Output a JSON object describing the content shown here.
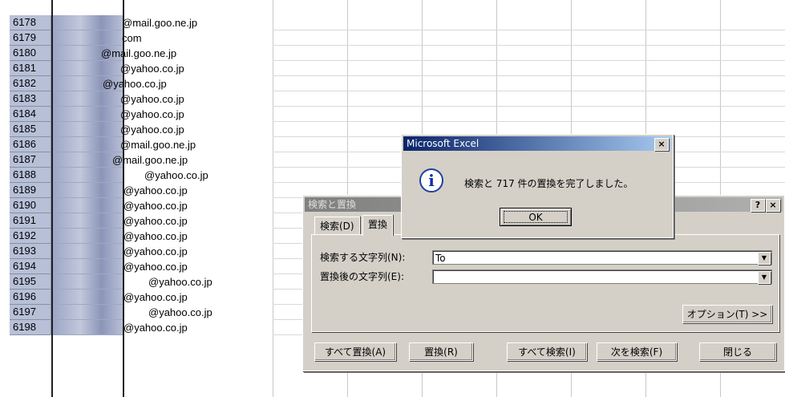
{
  "sheet": {
    "rows": [
      {
        "num": "6178",
        "email": "@mail.goo.ne.jp"
      },
      {
        "num": "6179",
        "email": "com"
      },
      {
        "num": "6180",
        "email": "@mail.goo.ne.jp"
      },
      {
        "num": "6181",
        "email": "@yahoo.co.jp"
      },
      {
        "num": "6182",
        "email": "@yahoo.co.jp"
      },
      {
        "num": "6183",
        "email": "@yahoo.co.jp"
      },
      {
        "num": "6184",
        "email": "@yahoo.co.jp"
      },
      {
        "num": "6185",
        "email": "@yahoo.co.jp"
      },
      {
        "num": "6186",
        "email": "@mail.goo.ne.jp"
      },
      {
        "num": "6187",
        "email": "@mail.goo.ne.jp"
      },
      {
        "num": "6188",
        "email": "@yahoo.co.jp"
      },
      {
        "num": "6189",
        "email": "@yahoo.co.jp"
      },
      {
        "num": "6190",
        "email": "@yahoo.co.jp"
      },
      {
        "num": "6191",
        "email": "@yahoo.co.jp"
      },
      {
        "num": "6192",
        "email": "@yahoo.co.jp"
      },
      {
        "num": "6193",
        "email": "@yahoo.co.jp"
      },
      {
        "num": "6194",
        "email": "@yahoo.co.jp"
      },
      {
        "num": "6195",
        "email": "@yahoo.co.jp"
      },
      {
        "num": "6196",
        "email": "@yahoo.co.jp"
      },
      {
        "num": "6197",
        "email": "@yahoo.co.jp"
      },
      {
        "num": "6198",
        "email": "@yahoo.co.jp"
      }
    ]
  },
  "find_dialog": {
    "title": "検索と置換",
    "help_btn": "?",
    "close_btn": "×",
    "tab_find": "検索(D)",
    "tab_replace": "置換",
    "find_label": "検索する文字列(N):",
    "find_value": "To",
    "replace_label": "置換後の文字列(E):",
    "replace_value": "",
    "options_btn": "オプション(T) >>",
    "replace_all_btn": "すべて置換(A)",
    "replace_btn": "置換(R)",
    "find_all_btn": "すべて検索(I)",
    "find_next_btn": "次を検索(F)",
    "close_dialog_btn": "閉じる"
  },
  "msg_box": {
    "title": "Microsoft Excel",
    "close_btn": "×",
    "icon": "info-icon",
    "message": "検索と 717 件の置換を完了しました。",
    "ok_btn": "OK"
  }
}
